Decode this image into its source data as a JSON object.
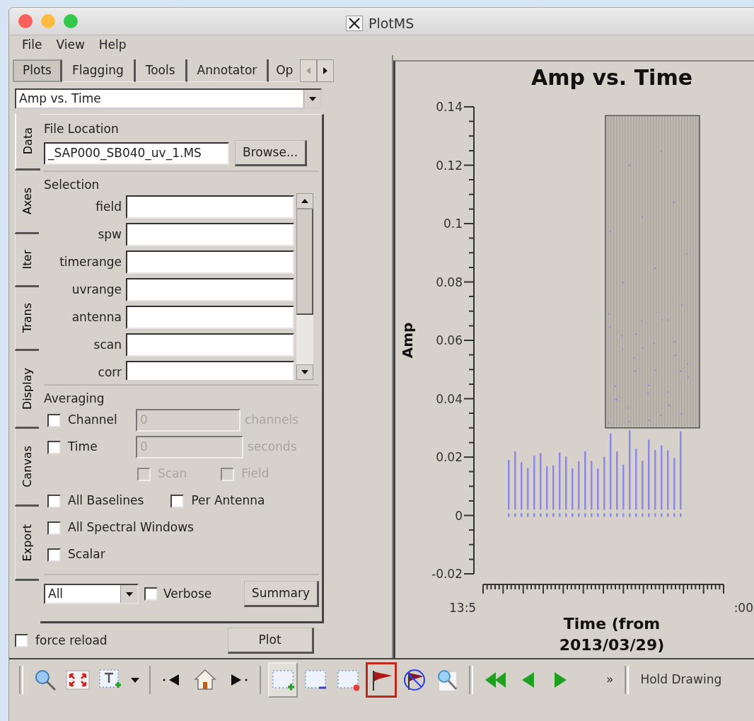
{
  "window": {
    "title": "PlotMS"
  },
  "menu": [
    {
      "label": "File"
    },
    {
      "label": "View"
    },
    {
      "label": "Help"
    }
  ],
  "tabs": [
    {
      "label": "Plots",
      "selected": true
    },
    {
      "label": "Flagging",
      "selected": false
    },
    {
      "label": "Tools",
      "selected": false
    },
    {
      "label": "Annotator",
      "selected": false
    },
    {
      "label": "Op",
      "selected": false
    }
  ],
  "plot_select": {
    "value": "Amp vs. Time"
  },
  "side_tabs": [
    {
      "label": "Data",
      "selected": true
    },
    {
      "label": "Axes",
      "selected": false
    },
    {
      "label": "Iter",
      "selected": false
    },
    {
      "label": "Trans",
      "selected": false
    },
    {
      "label": "Display",
      "selected": false
    },
    {
      "label": "Canvas",
      "selected": false
    },
    {
      "label": "Export",
      "selected": false
    }
  ],
  "file_location": {
    "heading": "File Location",
    "value": "_SAP000_SB040_uv_1.MS",
    "button": "Browse..."
  },
  "selection": {
    "heading": "Selection",
    "fields": [
      {
        "label": "field"
      },
      {
        "label": "spw"
      },
      {
        "label": "timerange"
      },
      {
        "label": "uvrange"
      },
      {
        "label": "antenna"
      },
      {
        "label": "scan"
      },
      {
        "label": "corr"
      }
    ]
  },
  "averaging": {
    "heading": "Averaging",
    "value_rows": [
      {
        "label": "Channel",
        "checked": false,
        "value": "0",
        "unit": "channels",
        "disabled": true
      },
      {
        "label": "Time",
        "checked": false,
        "value": "0",
        "unit": "seconds",
        "disabled": true
      }
    ],
    "option_rows": [
      {
        "kind": "sub",
        "items": [
          {
            "label": "Scan",
            "checked": false,
            "disabled": true
          },
          {
            "label": "Field",
            "checked": false,
            "disabled": true
          }
        ]
      },
      {
        "kind": "main",
        "items": [
          {
            "label": "All Baselines",
            "checked": false,
            "disabled": false
          },
          {
            "label": "Per Antenna",
            "checked": false,
            "disabled": false
          }
        ]
      },
      {
        "kind": "main",
        "items": [
          {
            "label": "All Spectral Windows",
            "checked": false,
            "disabled": false
          }
        ]
      },
      {
        "kind": "main",
        "items": [
          {
            "label": "Scalar",
            "checked": false,
            "disabled": false
          }
        ]
      }
    ]
  },
  "summary": {
    "select": "All",
    "verbose": {
      "label": "Verbose",
      "checked": false
    },
    "button": "Summary"
  },
  "force_reload": {
    "label": "force reload",
    "checked": false
  },
  "plot_button": "Plot",
  "plot": {
    "title": "Amp vs. Time",
    "ylabel": "Amp",
    "xlabel": "Time (from 2013/03/29)",
    "y_tick_labels": [
      "0.14",
      "0.12",
      "0.1",
      "0.08",
      "0.06",
      "0.04",
      "0.02",
      "0",
      "-0.02"
    ],
    "x_tick_labels": [
      "13:5",
      ":00"
    ]
  },
  "toolbar": [
    {
      "kind": "grip"
    },
    {
      "kind": "zoom",
      "pressed": false,
      "highlighted": false
    },
    {
      "kind": "fit",
      "pressed": false,
      "highlighted": false
    },
    {
      "kind": "annotate",
      "pressed": false,
      "highlighted": false
    },
    {
      "kind": "dropdown",
      "pressed": false,
      "highlighted": false
    },
    {
      "kind": "separator"
    },
    {
      "kind": "back",
      "pressed": false,
      "highlighted": false
    },
    {
      "kind": "home",
      "pressed": false,
      "highlighted": false
    },
    {
      "kind": "forward",
      "pressed": false,
      "highlighted": false
    },
    {
      "kind": "separator"
    },
    {
      "kind": "select_box",
      "pressed": true,
      "highlighted": false
    },
    {
      "kind": "subtract_box",
      "pressed": false,
      "highlighted": false
    },
    {
      "kind": "clear_box",
      "pressed": false,
      "highlighted": false
    },
    {
      "kind": "flag",
      "pressed": false,
      "highlighted": true
    },
    {
      "kind": "unflag",
      "pressed": false,
      "highlighted": false
    },
    {
      "kind": "locate",
      "pressed": false,
      "highlighted": false
    },
    {
      "kind": "grip"
    },
    {
      "kind": "first",
      "pressed": false,
      "highlighted": false
    },
    {
      "kind": "prev",
      "pressed": false,
      "highlighted": false
    },
    {
      "kind": "next",
      "pressed": false,
      "highlighted": false
    },
    {
      "kind": "more",
      "label": "»"
    },
    {
      "kind": "grip"
    },
    {
      "kind": "text",
      "label": "Hold Drawing"
    }
  ]
}
